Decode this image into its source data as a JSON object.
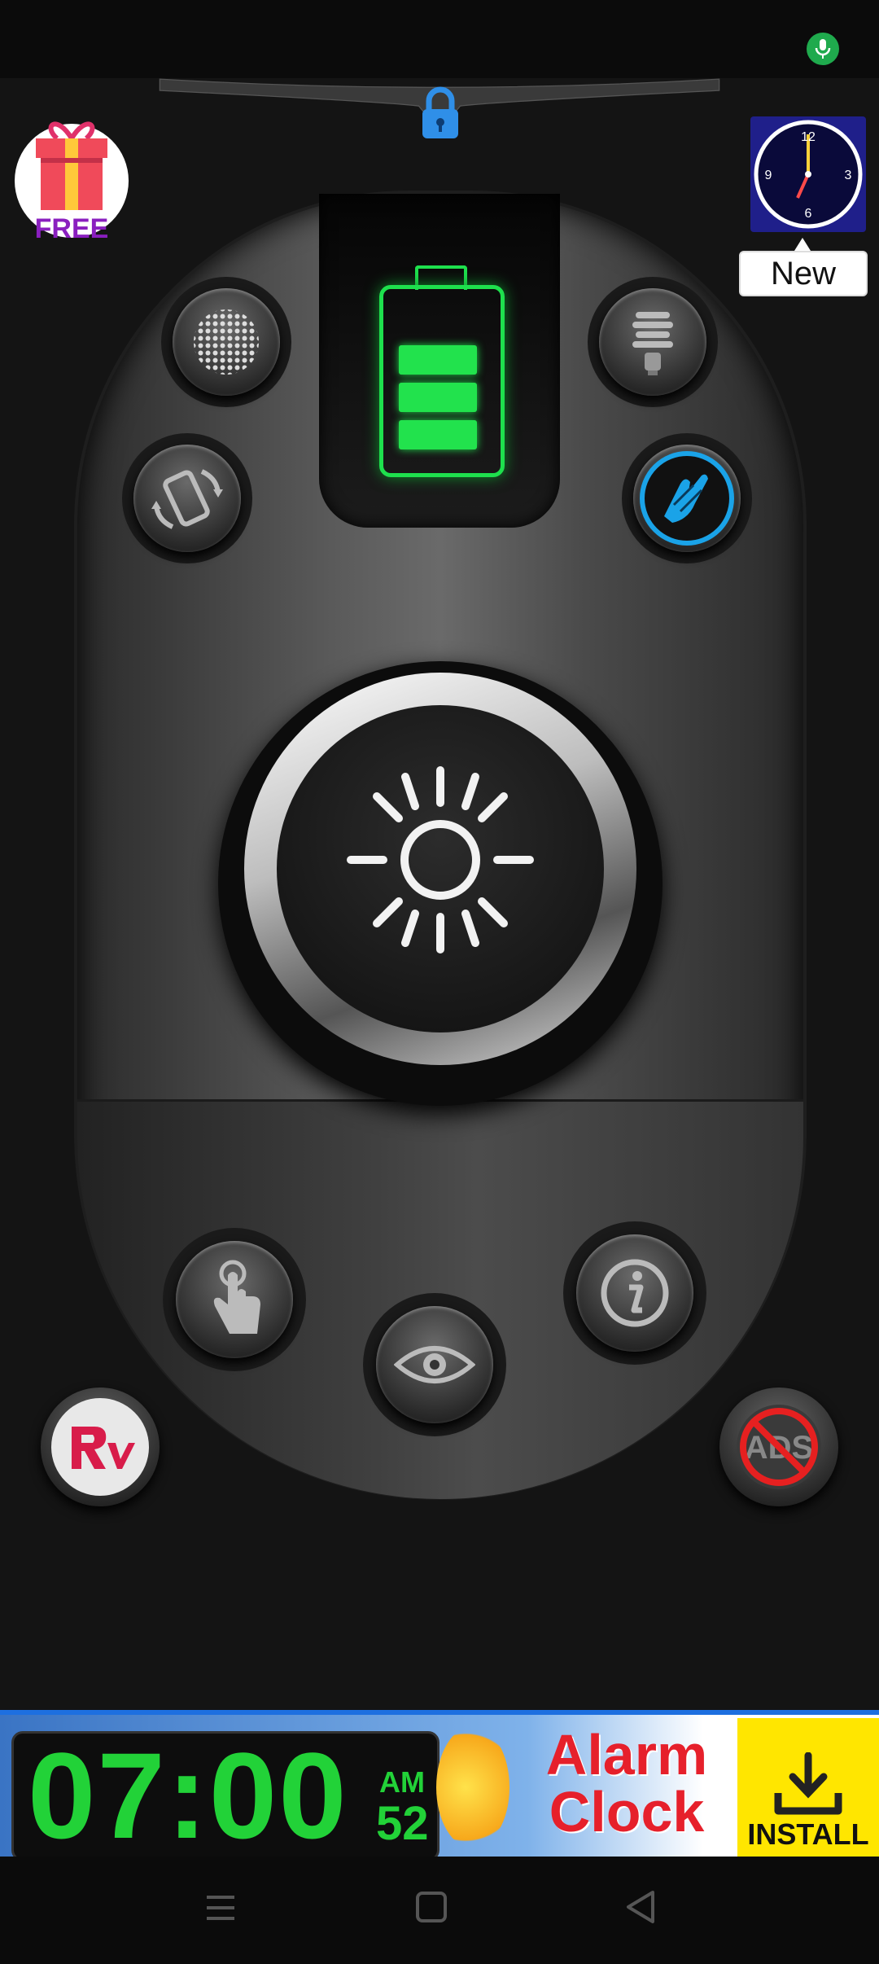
{
  "gift": {
    "label": "FREE"
  },
  "clock_widget": {
    "badge": "New",
    "dial_numbers": [
      "12",
      "3",
      "6",
      "9"
    ]
  },
  "banner": {
    "time": "07:00",
    "am_pm": "AM",
    "seconds": "52",
    "title_line1": "Alarm",
    "title_line2": "Clock",
    "install_label": "INSTALL"
  },
  "battery": {
    "level_bars": 3
  },
  "colors": {
    "battery_green": "#1ee04d",
    "clap_accent": "#1aa3e8",
    "banner_red": "#e6202b",
    "banner_yellow": "#ffe600"
  },
  "icons": [
    "mic-icon",
    "lock-icon",
    "gift-icon",
    "clock-icon",
    "disco-ball-icon",
    "bulb-icon",
    "rotate-phone-icon",
    "clap-hands-icon",
    "sun-icon",
    "touch-icon",
    "info-icon",
    "eye-icon",
    "rv-logo-icon",
    "no-ads-icon",
    "download-icon",
    "menu-icon",
    "home-icon",
    "back-icon"
  ]
}
